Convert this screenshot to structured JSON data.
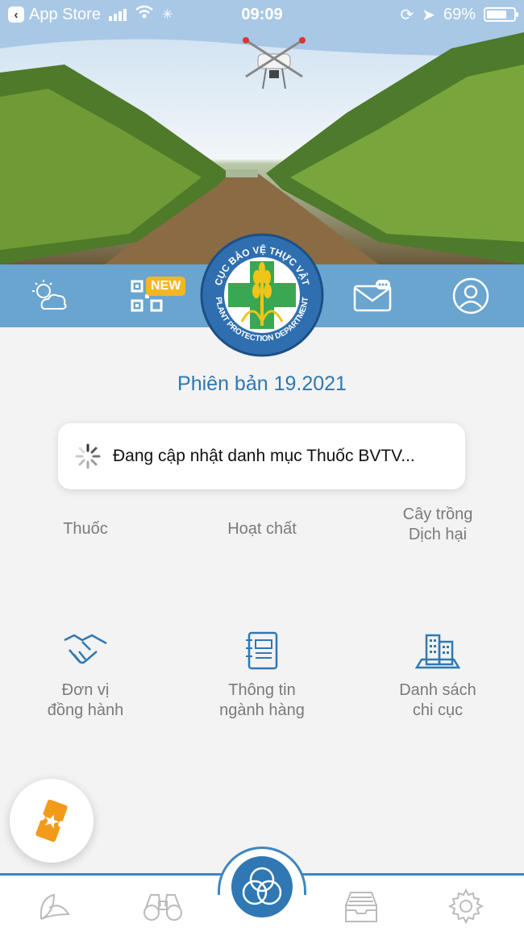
{
  "status_bar": {
    "back_app": "App Store",
    "time": "09:09",
    "battery": "69%"
  },
  "toolbar": {
    "new_badge": "NEW"
  },
  "logo": {
    "top_text": "CỤC BẢO VỆ THỰC VẬT",
    "bottom_text": "PLANT PROTECTION DEPARTMENT"
  },
  "version": "Phiên bản 19.2021",
  "toast": {
    "message": "Đang cập nhật danh mục Thuốc BVTV..."
  },
  "grid": {
    "thuoc": "Thuốc",
    "hoat_chat": "Hoạt chất",
    "cay_trong_1": "Cây trồng",
    "cay_trong_2": "Dịch hại",
    "don_vi_1": "Đơn vị",
    "don_vi_2": "đồng hành",
    "thong_tin_1": "Thông tin",
    "thong_tin_2": "ngành hàng",
    "danh_sach_1": "Danh sách",
    "danh_sach_2": "chi cục"
  },
  "colors": {
    "primary_blue": "#2f78b4",
    "toolbar_blue": "#6aa5cf",
    "badge_yellow": "#f5b623",
    "ticket_orange": "#f29a1a",
    "version_text": "#2f77b0"
  },
  "icons": {
    "weather": "weather-icon",
    "qr": "qr-code-icon",
    "message": "message-icon",
    "profile": "profile-icon",
    "leaf": "leaf-icon",
    "binoculars": "binoculars-icon",
    "home": "home-circles-icon",
    "inbox": "inbox-icon",
    "settings": "gear-icon"
  }
}
